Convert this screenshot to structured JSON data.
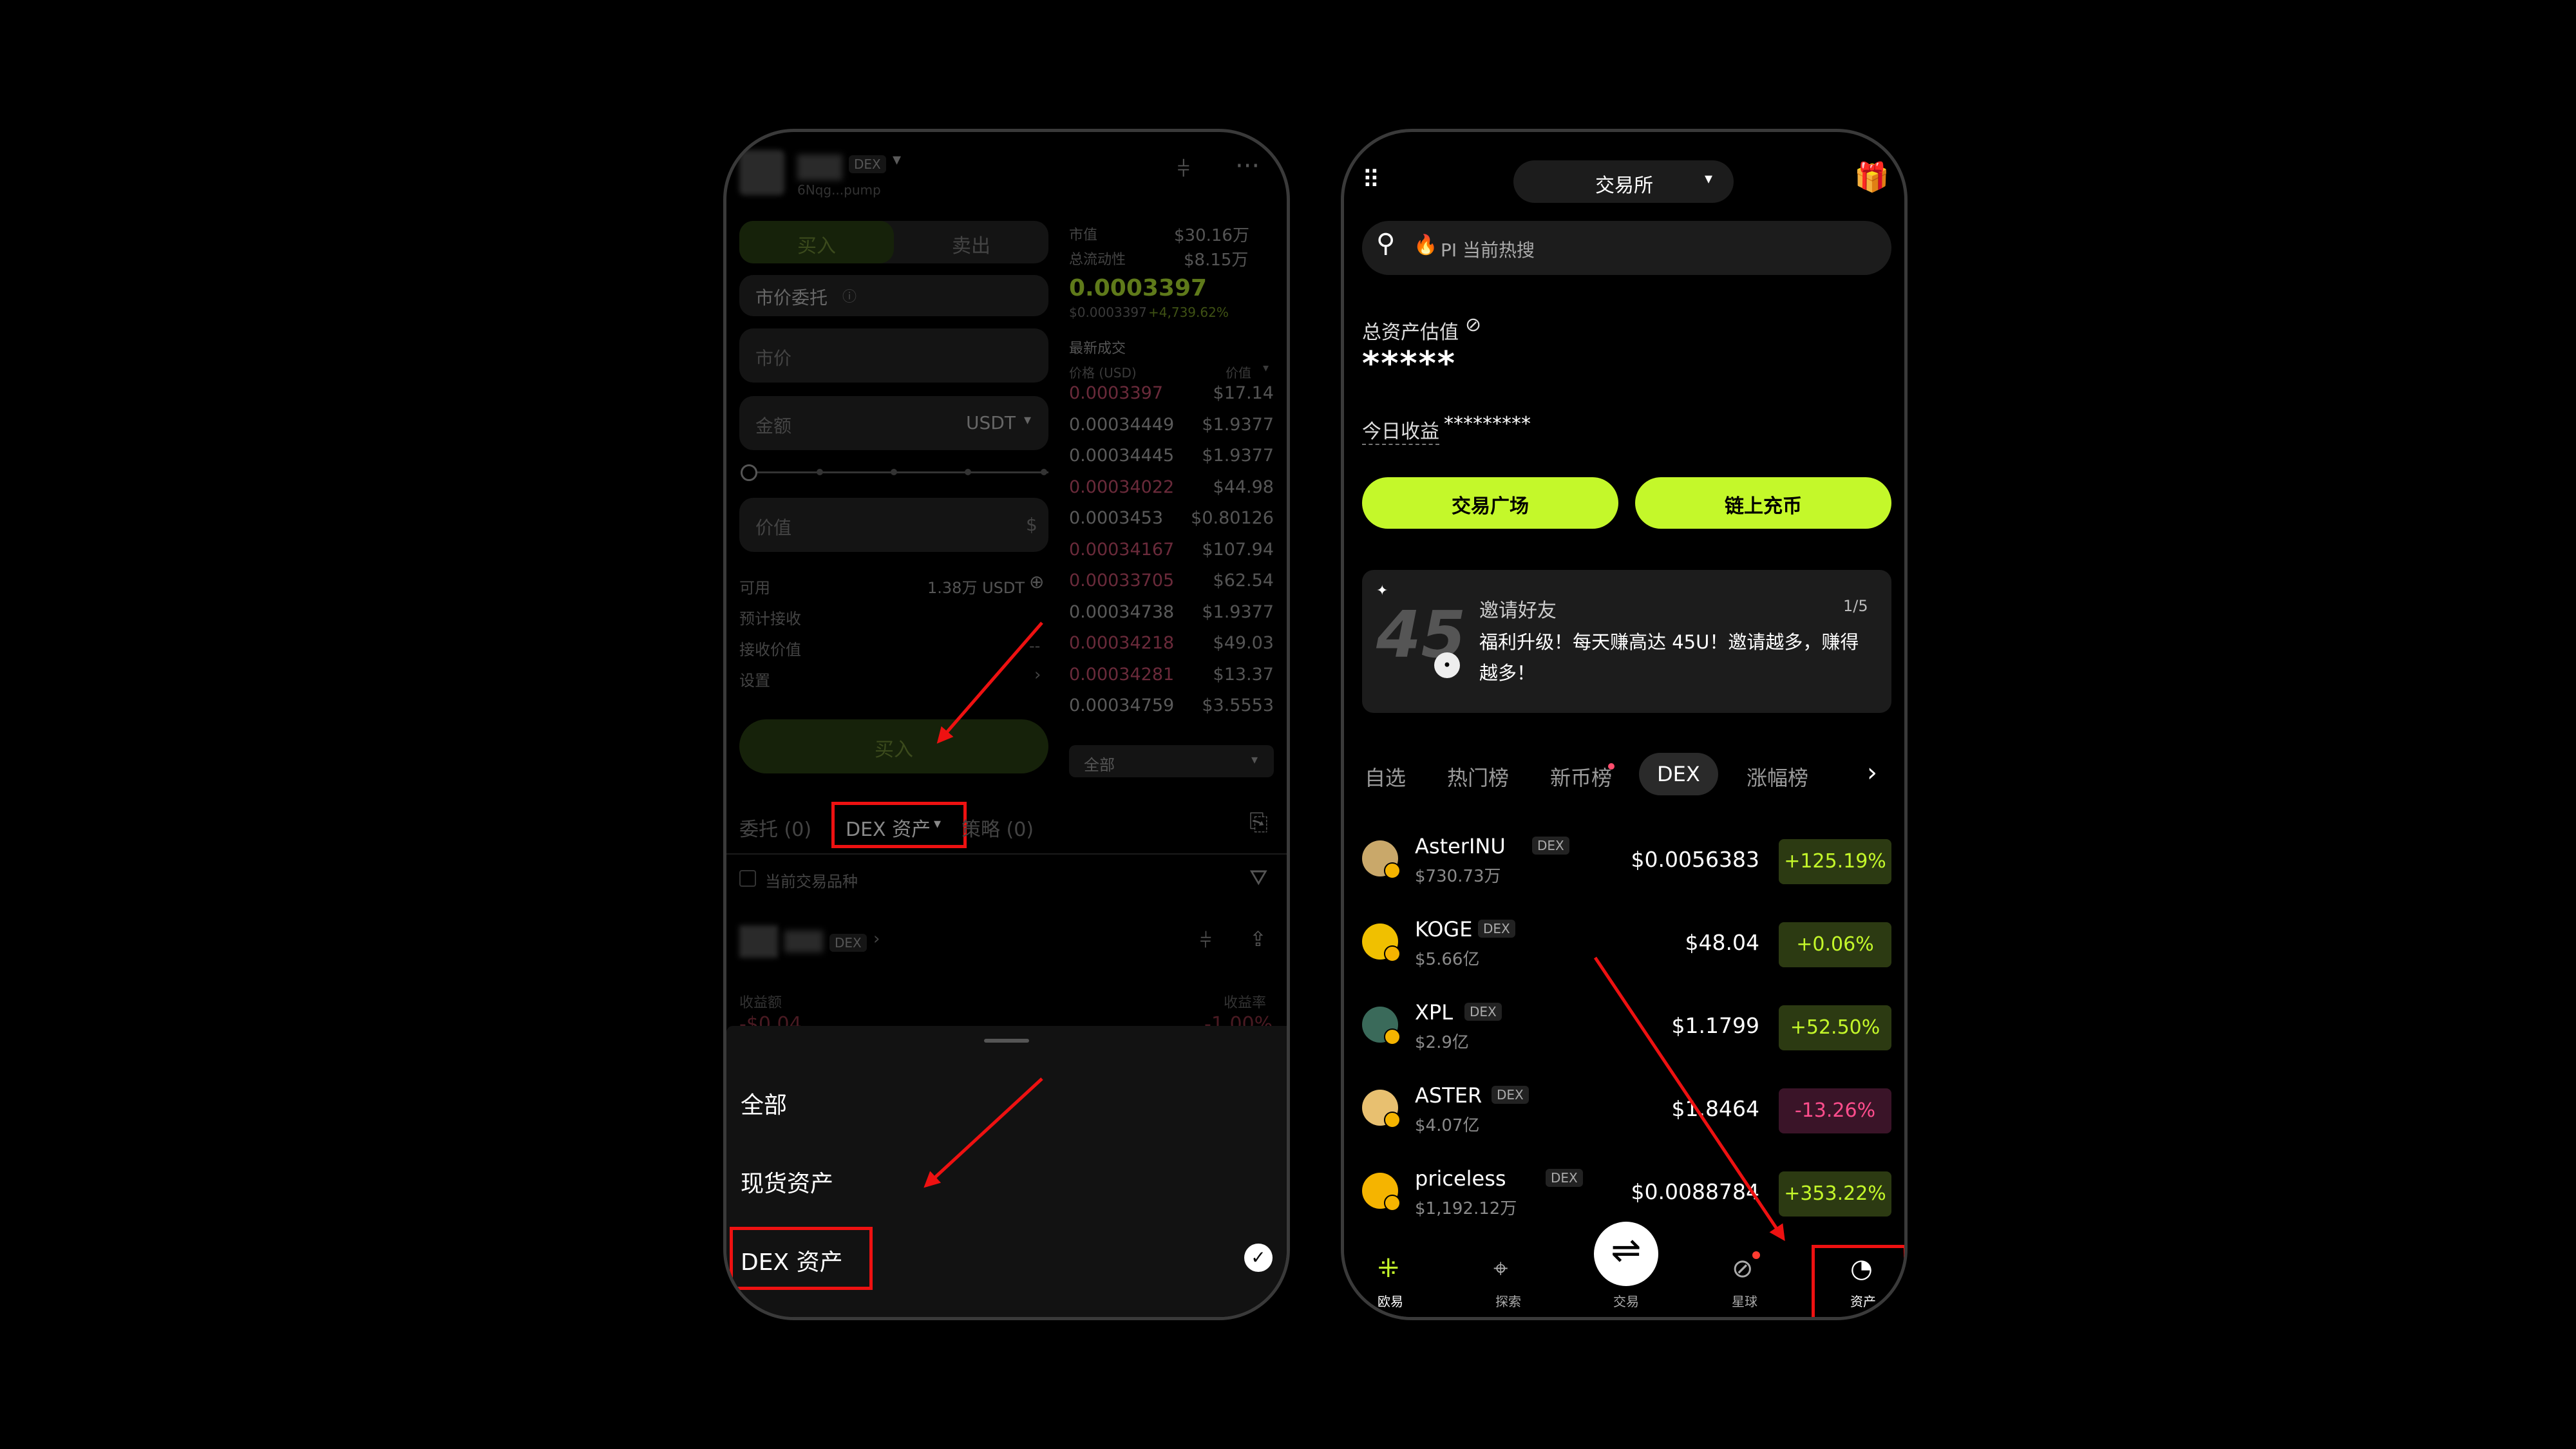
{
  "left": {
    "header": {
      "dex_badge": "DEX",
      "subtitle": "6Nqg...pump"
    },
    "trade": {
      "buy_tab": "买入",
      "sell_tab": "卖出",
      "order_type": "市价委托",
      "price_field": "市价",
      "amount_placeholder": "金额",
      "amount_unit": "USDT",
      "value_placeholder": "价值",
      "value_unit": "$",
      "available_label": "可用",
      "available_value": "1.38万 USDT",
      "expected_label": "预计接收",
      "receive_price_label": "接收价值",
      "receive_price_value": "--",
      "settings_label": "设置",
      "buy_button": "买入"
    },
    "market": {
      "cap_label": "市值",
      "cap_value": "$30.16万",
      "liq_label": "总流动性",
      "liq_value": "$8.15万",
      "price": "0.0003397",
      "price_sub": "$0.0003397",
      "change": "+4,739.62%",
      "latest_label": "最新成交",
      "col_price": "价格 (USD)",
      "col_value": "价值",
      "trades": [
        {
          "p": "0.0003397",
          "v": "$17.14",
          "side": "ask"
        },
        {
          "p": "0.00034449",
          "v": "$1.9377",
          "side": "bid"
        },
        {
          "p": "0.00034445",
          "v": "$1.9377",
          "side": "bid"
        },
        {
          "p": "0.00034022",
          "v": "$44.98",
          "side": "ask"
        },
        {
          "p": "0.0003453",
          "v": "$0.80126",
          "side": "bid"
        },
        {
          "p": "0.00034167",
          "v": "$107.94",
          "side": "ask"
        },
        {
          "p": "0.00033705",
          "v": "$62.54",
          "side": "ask"
        },
        {
          "p": "0.00034738",
          "v": "$1.9377",
          "side": "bid"
        },
        {
          "p": "0.00034218",
          "v": "$49.03",
          "side": "ask"
        },
        {
          "p": "0.00034281",
          "v": "$13.37",
          "side": "ask"
        },
        {
          "p": "0.00034759",
          "v": "$3.5553",
          "side": "bid"
        }
      ],
      "filter": "全部"
    },
    "tabs": {
      "orders": "委托 (0)",
      "dex_assets": "DEX 资产",
      "strategy": "策略 (0)"
    },
    "current_pair": "当前交易品种",
    "position": {
      "badge": "DEX",
      "pnl_label": "收益额",
      "pnl_rate_label": "收益率",
      "pnl_value": "-$0.04",
      "pnl_rate_value": "-1.00%"
    },
    "sheet": {
      "items": [
        "全部",
        "现货资产",
        "DEX 资产"
      ]
    }
  },
  "right": {
    "header": {
      "mode": "交易所"
    },
    "search": {
      "placeholder": "PI 当前热搜"
    },
    "assets": {
      "label": "总资产估值",
      "value": "*****",
      "today_label": "今日收益",
      "today_value": "*********"
    },
    "buttons": {
      "plaza": "交易广场",
      "deposit": "链上充币"
    },
    "invite": {
      "number": "45",
      "title": "邀请好友",
      "page": "1/5",
      "text": "福利升级！每天赚高达 45U！邀请越多，赚得越多！"
    },
    "tabs": [
      "自选",
      "热门榜",
      "新币榜",
      "DEX",
      "涨幅榜"
    ],
    "coins": [
      {
        "name": "AsterINU",
        "cap": "$730.73万",
        "price": "$0.0056383",
        "chg": "+125.19%",
        "dir": "up"
      },
      {
        "name": "KOGE",
        "cap": "$5.66亿",
        "price": "$48.04",
        "chg": "+0.06%",
        "dir": "up"
      },
      {
        "name": "XPL",
        "cap": "$2.9亿",
        "price": "$1.1799",
        "chg": "+52.50%",
        "dir": "up"
      },
      {
        "name": "ASTER",
        "cap": "$4.07亿",
        "price": "$1.8464",
        "chg": "-13.26%",
        "dir": "down"
      },
      {
        "name": "priceless",
        "cap": "$1,192.12万",
        "price": "$0.0088784",
        "chg": "+353.22%",
        "dir": "up"
      }
    ],
    "dex_badge": "DEX",
    "nav": [
      "欧易",
      "探索",
      "交易",
      "星球",
      "资产"
    ]
  },
  "colors": {
    "neon": "#c4f82a",
    "annotation_red": "#e11111",
    "down": "#ff4d8d"
  }
}
